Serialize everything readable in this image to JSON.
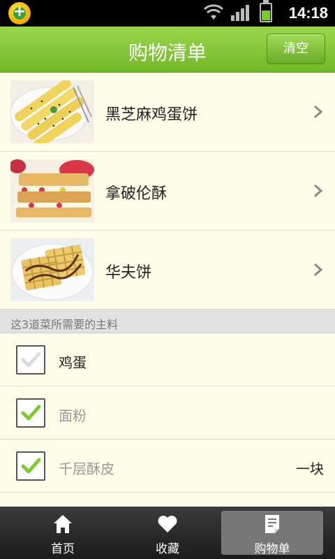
{
  "status_bar": {
    "time": "14:18",
    "battery_level": 0.6
  },
  "header": {
    "title": "购物清单",
    "clear_label": "清空"
  },
  "recipes": [
    {
      "name": "黑芝麻鸡蛋饼"
    },
    {
      "name": "拿破伦酥"
    },
    {
      "name": "华夫饼"
    }
  ],
  "ingredients_section": {
    "title": "这3道菜所需要的主料"
  },
  "ingredients": [
    {
      "name": "鸡蛋",
      "amount": "",
      "checked": false
    },
    {
      "name": "面粉",
      "amount": "",
      "checked": true
    },
    {
      "name": "千层酥皮",
      "amount": "一块",
      "checked": true
    }
  ],
  "bottom_nav": [
    {
      "label": "首页",
      "icon": "home-icon",
      "active": false
    },
    {
      "label": "收藏",
      "icon": "heart-icon",
      "active": false
    },
    {
      "label": "购物单",
      "icon": "shopping-list-icon",
      "active": true
    }
  ],
  "colors": {
    "accent_green": "#7ccd2c",
    "header_green": "#8acd3f",
    "background": "#fefde8"
  }
}
